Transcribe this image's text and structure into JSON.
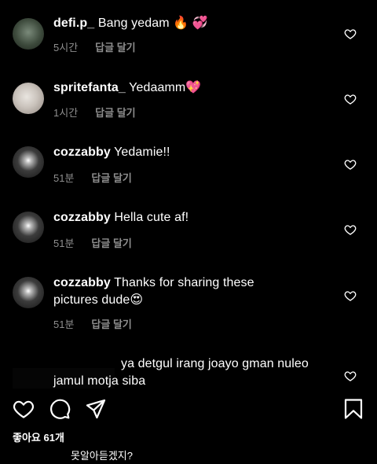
{
  "comments": [
    {
      "username": "defi.p_",
      "text": "Bang yedam 🔥 💞",
      "time": "5시간",
      "reply_label": "답글 달기",
      "avatar_icon": "avatar-icon"
    },
    {
      "username": "spritefanta_",
      "text": "Yedaamm💖",
      "time": "1시간",
      "reply_label": "답글 달기",
      "avatar_icon": "avatar-icon"
    },
    {
      "username": "cozzabby",
      "text": "Yedamie!!",
      "time": "51분",
      "reply_label": "답글 달기",
      "avatar_icon": "avatar-icon"
    },
    {
      "username": "cozzabby",
      "text": "Hella cute af!",
      "time": "51분",
      "reply_label": "답글 달기",
      "avatar_icon": "avatar-icon"
    },
    {
      "username": "cozzabby",
      "text": "Thanks for sharing these pictures dude😍",
      "time": "51분",
      "reply_label": "답글 달기",
      "avatar_icon": "avatar-icon"
    },
    {
      "username": "",
      "text": "ya detgul irang joayo gman nuleo jamul motja siba",
      "time": "",
      "reply_label": "",
      "avatar_icon": "avatar-icon"
    }
  ],
  "actions": {
    "like_icon": "heart-outline-icon",
    "comment_icon": "comment-bubble-icon",
    "share_icon": "paper-plane-icon",
    "save_icon": "bookmark-icon"
  },
  "likes_text": "좋아요 61개",
  "caption_text": "못알아듣겠지?"
}
